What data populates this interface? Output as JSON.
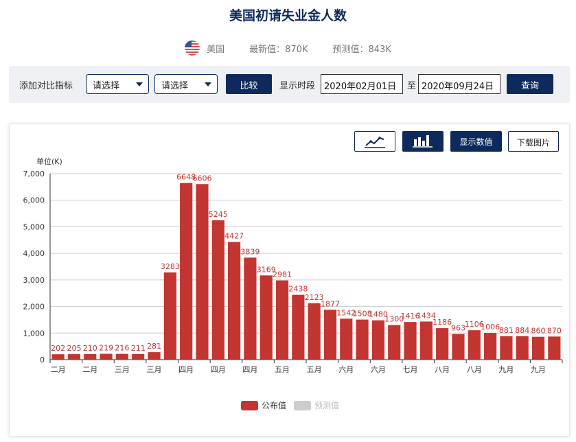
{
  "header": {
    "title": "美国初请失业金人数",
    "country": "美国",
    "latest_label": "最新值：870K",
    "forecast_label": "预测值：843K"
  },
  "toolbar": {
    "compare_label": "添加对比指标",
    "select1": "请选择",
    "select2": "请选择",
    "compare_button": "比较",
    "period_label": "显示时段",
    "date_from": "2020年02月01日",
    "to_label": "至",
    "date_to": "2020年09月24日",
    "query_button": "查询"
  },
  "chart_controls": {
    "show_values": "显示数值",
    "download": "下载图片"
  },
  "colors": {
    "bar": "#c23531",
    "navy": "#0e2a5c",
    "legend_inactive": "#cccccc"
  },
  "chart_data": {
    "type": "bar",
    "unit_label": "单位(K)",
    "ylim": [
      0,
      7000
    ],
    "yticks": [
      0,
      1000,
      2000,
      3000,
      4000,
      5000,
      6000,
      7000
    ],
    "ytick_labels": [
      "0",
      "1,000",
      "2,000",
      "3,000",
      "4,000",
      "5,000",
      "6,000",
      "7,000"
    ],
    "categories": [
      "二月",
      "二月",
      "二月",
      "二月",
      "三月",
      "三月",
      "三月",
      "三月",
      "四月",
      "四月",
      "四月",
      "四月",
      "四月",
      "五月",
      "五月",
      "五月",
      "五月",
      "六月",
      "六月",
      "六月",
      "六月",
      "七月",
      "七月",
      "七月",
      "七月",
      "八月",
      "八月",
      "八月",
      "八月",
      "九月",
      "九月",
      "九月",
      "九月"
    ],
    "visible_tick_labels": [
      "二月",
      "二月",
      "三月",
      "三月",
      "四月",
      "四月",
      "四月",
      "五月",
      "五月",
      "六月",
      "六月",
      "七月",
      "八月",
      "八月",
      "九月",
      "九月"
    ],
    "series": [
      {
        "name": "公布值",
        "values": [
          202,
          205,
          210,
          219,
          216,
          211,
          281,
          3283,
          6648,
          6606,
          5245,
          4427,
          3839,
          3169,
          2981,
          2438,
          2123,
          1877,
          1542,
          1508,
          1480,
          1300,
          1416,
          1434,
          1186,
          963,
          1106,
          1006,
          881,
          884,
          860,
          870
        ]
      },
      {
        "name": "预测值",
        "values": []
      }
    ],
    "grid": true,
    "legend_position": "bottom-center"
  }
}
